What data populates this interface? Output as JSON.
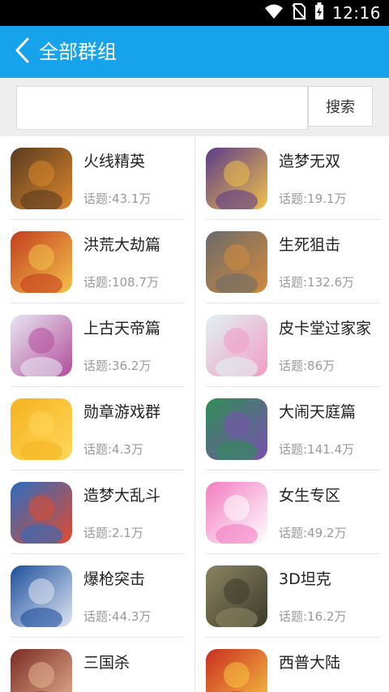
{
  "status": {
    "time": "12:16"
  },
  "header": {
    "title": "全部群组"
  },
  "search": {
    "placeholder": "",
    "button_label": "搜索"
  },
  "groups": [
    {
      "name": "火线精英",
      "topics": "话题:43.1万",
      "icon": "soldier-gun-icon",
      "colors": [
        "#5a3b22",
        "#d9862a"
      ]
    },
    {
      "name": "造梦无双",
      "topics": "话题:19.1万",
      "icon": "monkey-king-icon",
      "colors": [
        "#5b3b8a",
        "#f1c14b"
      ]
    },
    {
      "name": "洪荒大劫篇",
      "topics": "话题:108.7万",
      "icon": "warrior-monkey-icon",
      "colors": [
        "#c43d1e",
        "#f3c24a"
      ]
    },
    {
      "name": "生死狙击",
      "topics": "话题:132.6万",
      "icon": "sniper-man-icon",
      "colors": [
        "#6b6b6b",
        "#d28a3c"
      ]
    },
    {
      "name": "上古天帝篇",
      "topics": "话题:36.2万",
      "icon": "cat-mask-icon",
      "colors": [
        "#e8e6f3",
        "#b24d9a"
      ]
    },
    {
      "name": "皮卡堂过家家",
      "topics": "话题:86万",
      "icon": "anime-girl-icon",
      "colors": [
        "#dff3f2",
        "#f39bc4"
      ]
    },
    {
      "name": "勋章游戏群",
      "topics": "话题:4.3万",
      "icon": "gold-star-icon",
      "colors": [
        "#f5b21f",
        "#ffd75a"
      ]
    },
    {
      "name": "大闹天庭篇",
      "topics": "话题:141.4万",
      "icon": "green-warrior-icon",
      "colors": [
        "#2f8f55",
        "#7a4fb1"
      ]
    },
    {
      "name": "造梦大乱斗",
      "topics": "话题:2.1万",
      "icon": "red-monkey-icon",
      "colors": [
        "#2a6dc2",
        "#e24a2d"
      ]
    },
    {
      "name": "女生专区",
      "topics": "话题:49.2万",
      "icon": "girl-portrait-icon",
      "colors": [
        "#f27bc1",
        "#ffffff"
      ]
    },
    {
      "name": "爆枪突击",
      "topics": "话题:44.3万",
      "icon": "gunner-boy-icon",
      "colors": [
        "#1c4f9c",
        "#e0e6f2"
      ]
    },
    {
      "name": "3D坦克",
      "topics": "话题:16.2万",
      "icon": "tank-icon",
      "colors": [
        "#8a8562",
        "#3c3a2a"
      ]
    },
    {
      "name": "三国杀",
      "topics": "",
      "icon": "warlord-face-icon",
      "colors": [
        "#7b2b23",
        "#e4b392"
      ]
    },
    {
      "name": "西普大陆",
      "topics": "",
      "icon": "fire-creature-icon",
      "colors": [
        "#c92d22",
        "#f7c541"
      ]
    }
  ]
}
